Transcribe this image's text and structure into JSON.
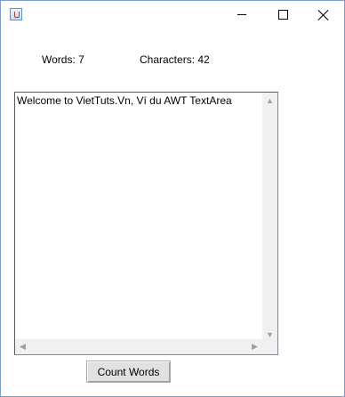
{
  "window": {
    "icon": "java-app-icon",
    "controls": [
      "minimize-icon",
      "maximize-icon",
      "close-icon"
    ]
  },
  "stats": {
    "words": "Words: 7",
    "characters": "Characters: 42"
  },
  "textarea": {
    "value": "Welcome to VietTuts.Vn, Ví du AWT TextArea"
  },
  "button": {
    "label": "Count Words"
  },
  "colors": {
    "window_border": "#7a9cc6",
    "scrollbar": "#f0f0f0",
    "button_face": "#e1e1e1"
  }
}
